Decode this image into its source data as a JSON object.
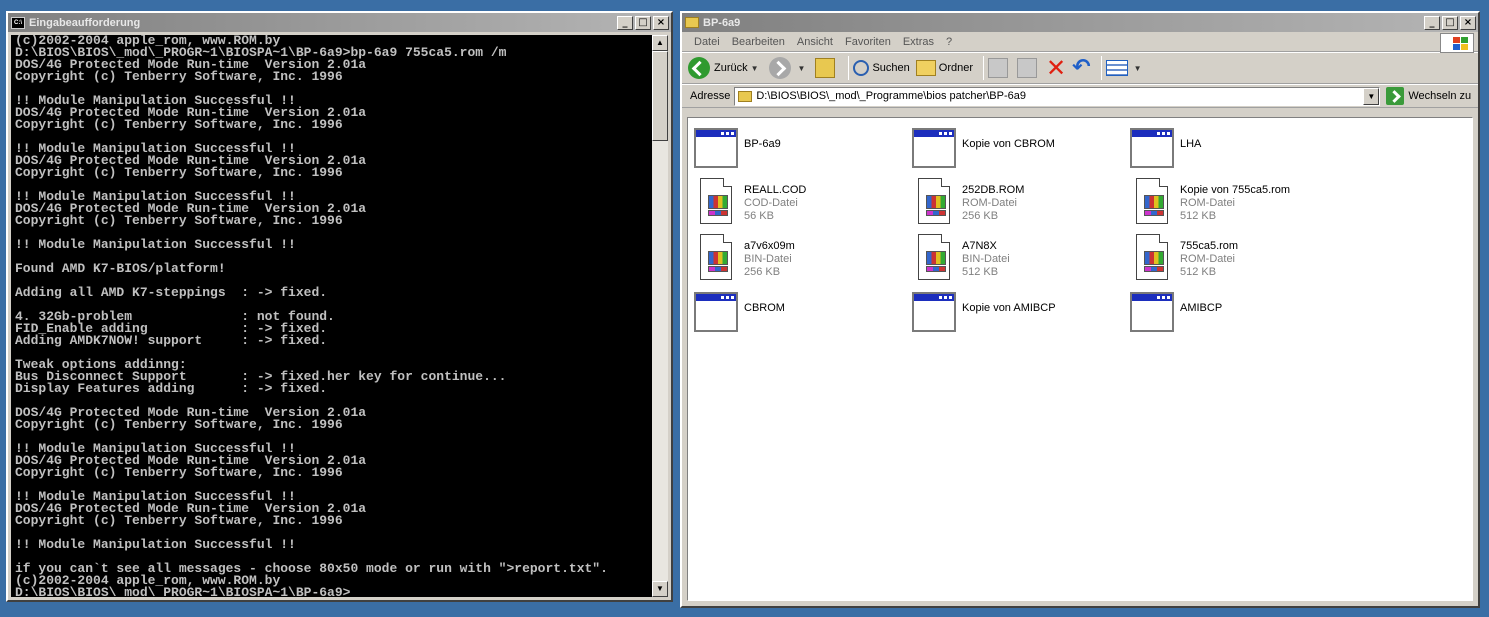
{
  "console": {
    "title": "Eingabeaufforderung",
    "icon_text": "C:\\",
    "lines": [
      "(c)2002-2004 apple_rom, www.ROM.by",
      "D:\\BIOS\\BIOS\\_mod\\_PROGR~1\\BIOSPA~1\\BP-6a9>bp-6a9 755ca5.rom /m",
      "DOS/4G Protected Mode Run-time  Version 2.01a",
      "Copyright (c) Tenberry Software, Inc. 1996",
      "",
      "!! Module Manipulation Successful !!",
      "DOS/4G Protected Mode Run-time  Version 2.01a",
      "Copyright (c) Tenberry Software, Inc. 1996",
      "",
      "!! Module Manipulation Successful !!",
      "DOS/4G Protected Mode Run-time  Version 2.01a",
      "Copyright (c) Tenberry Software, Inc. 1996",
      "",
      "!! Module Manipulation Successful !!",
      "DOS/4G Protected Mode Run-time  Version 2.01a",
      "Copyright (c) Tenberry Software, Inc. 1996",
      "",
      "!! Module Manipulation Successful !!",
      "",
      "Found AMD K7-BIOS/platform!",
      "",
      "Adding all AMD K7-steppings  : -> fixed.",
      "",
      "4. 32Gb-problem              : not found.",
      "FID_Enable adding            : -> fixed.",
      "Adding AMDK7NOW! support     : -> fixed.",
      "",
      "Tweak options addinng:",
      "Bus Disconnect Support       : -> fixed.her key for continue...",
      "Display Features adding      : -> fixed.",
      "",
      "DOS/4G Protected Mode Run-time  Version 2.01a",
      "Copyright (c) Tenberry Software, Inc. 1996",
      "",
      "!! Module Manipulation Successful !!",
      "DOS/4G Protected Mode Run-time  Version 2.01a",
      "Copyright (c) Tenberry Software, Inc. 1996",
      "",
      "!! Module Manipulation Successful !!",
      "DOS/4G Protected Mode Run-time  Version 2.01a",
      "Copyright (c) Tenberry Software, Inc. 1996",
      "",
      "!! Module Manipulation Successful !!",
      "",
      "if you can`t see all messages - choose 80x50 mode or run with \">report.txt\".",
      "(c)2002-2004 apple_rom, www.ROM.by",
      "D:\\BIOS\\BIOS\\_mod\\_PROGR~1\\BIOSPA~1\\BP-6a9>"
    ]
  },
  "explorer": {
    "title": "BP-6a9",
    "menu": [
      "Datei",
      "Bearbeiten",
      "Ansicht",
      "Favoriten",
      "Extras",
      "?"
    ],
    "toolbar": {
      "back": "Zurück",
      "search": "Suchen",
      "folders": "Ordner"
    },
    "address": {
      "label": "Adresse",
      "value": "D:\\BIOS\\BIOS\\_mod\\_Programme\\bios patcher\\BP-6a9",
      "go": "Wechseln zu"
    },
    "files": [
      {
        "name": "BP-6a9",
        "kind": "app"
      },
      {
        "name": "Kopie von CBROM",
        "kind": "app"
      },
      {
        "name": "LHA",
        "kind": "app"
      },
      {
        "name": "REALL.COD",
        "type": "COD-Datei",
        "size": "56 KB",
        "kind": "doc"
      },
      {
        "name": "252DB.ROM",
        "type": "ROM-Datei",
        "size": "256 KB",
        "kind": "doc"
      },
      {
        "name": "Kopie von 755ca5.rom",
        "type": "ROM-Datei",
        "size": "512 KB",
        "kind": "doc"
      },
      {
        "name": "a7v6x09m",
        "type": "BIN-Datei",
        "size": "256 KB",
        "kind": "doc"
      },
      {
        "name": "A7N8X",
        "type": "BIN-Datei",
        "size": "512 KB",
        "kind": "doc"
      },
      {
        "name": "755ca5.rom",
        "type": "ROM-Datei",
        "size": "512 KB",
        "kind": "doc"
      },
      {
        "name": "CBROM",
        "kind": "app"
      },
      {
        "name": "Kopie von AMIBCP",
        "kind": "app"
      },
      {
        "name": "AMIBCP",
        "kind": "app"
      }
    ]
  }
}
